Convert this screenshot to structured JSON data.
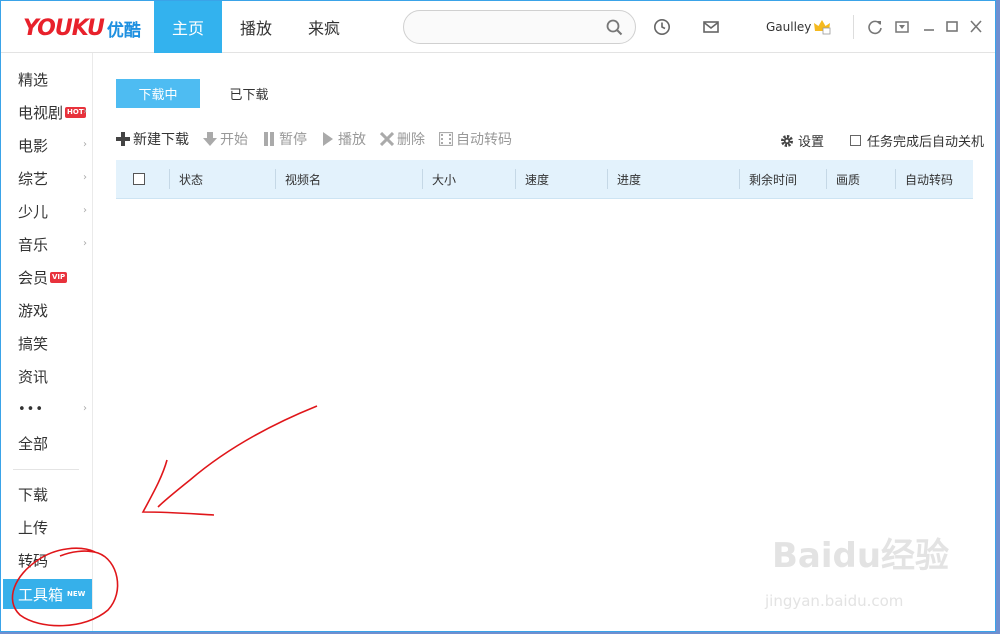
{
  "app": {
    "logo_text": "YOUKU",
    "logo_cn": "优酷"
  },
  "nav": {
    "tabs": [
      {
        "label": "主页",
        "active": true
      },
      {
        "label": "播放",
        "active": false
      },
      {
        "label": "来疯",
        "active": false
      }
    ]
  },
  "search": {
    "value": "",
    "placeholder": ""
  },
  "user": {
    "name": "Gaulley"
  },
  "sidebar": {
    "items": [
      {
        "label": "精选",
        "badge": "",
        "chevron": false
      },
      {
        "label": "电视剧",
        "badge": "HOT",
        "chevron": true
      },
      {
        "label": "电影",
        "badge": "",
        "chevron": true
      },
      {
        "label": "综艺",
        "badge": "",
        "chevron": true
      },
      {
        "label": "少儿",
        "badge": "",
        "chevron": true
      },
      {
        "label": "音乐",
        "badge": "",
        "chevron": true
      },
      {
        "label": "会员",
        "badge": "VIP",
        "chevron": false
      },
      {
        "label": "游戏",
        "badge": "",
        "chevron": false
      },
      {
        "label": "搞笑",
        "badge": "",
        "chevron": false
      },
      {
        "label": "资讯",
        "badge": "",
        "chevron": false
      },
      {
        "label": "•••",
        "badge": "",
        "chevron": true
      },
      {
        "label": "全部",
        "badge": "",
        "chevron": false
      }
    ],
    "bottom_items": [
      {
        "label": "下载",
        "badge": ""
      },
      {
        "label": "上传",
        "badge": ""
      },
      {
        "label": "转码",
        "badge": ""
      },
      {
        "label": "工具箱",
        "badge": "NEW"
      }
    ],
    "chevron_glyph": "›"
  },
  "download": {
    "tabs": [
      {
        "label": "下载中",
        "active": true
      },
      {
        "label": "已下载",
        "active": false
      }
    ],
    "toolbar": {
      "new_download": "新建下载",
      "start": "开始",
      "pause": "暂停",
      "play": "播放",
      "delete": "删除",
      "auto_transcode": "自动转码",
      "settings": "设置",
      "auto_shutdown": "任务完成后自动关机"
    },
    "columns": [
      "状态",
      "视频名",
      "大小",
      "速度",
      "进度",
      "剩余时间",
      "画质",
      "自动转码"
    ]
  },
  "watermark": {
    "main": "Baidu经验",
    "sub": "jingyan.baidu.com"
  },
  "colors": {
    "accent": "#33b2ee",
    "logo_red": "#e8212b",
    "annotation": "#e0161a"
  }
}
